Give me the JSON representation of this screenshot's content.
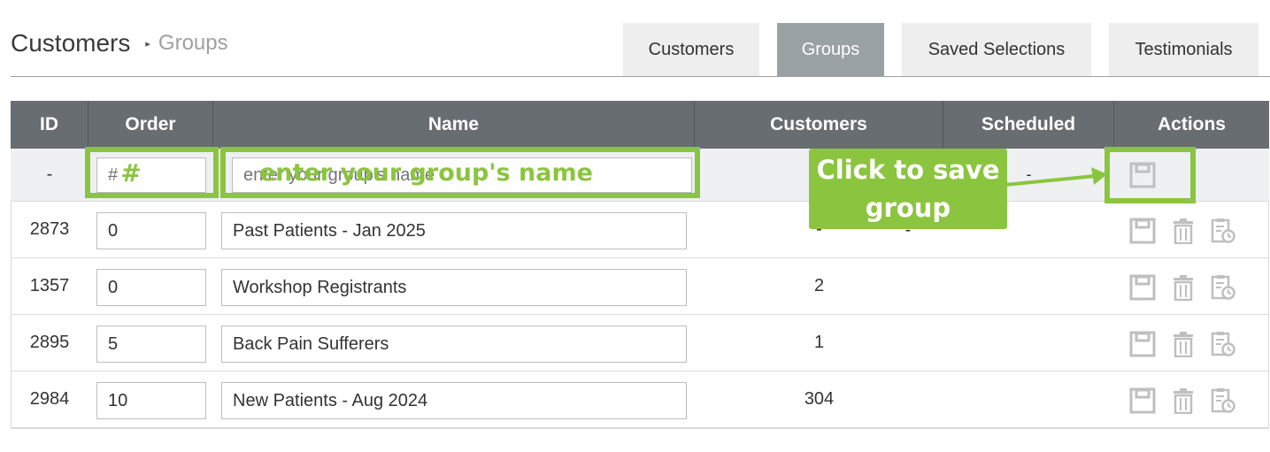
{
  "breadcrumb": {
    "main": "Customers",
    "separator": "▸",
    "current": "Groups"
  },
  "tabs": [
    {
      "label": "Customers",
      "active": false
    },
    {
      "label": "Groups",
      "active": true
    },
    {
      "label": "Saved Selections",
      "active": false
    },
    {
      "label": "Testimonials",
      "active": false
    }
  ],
  "table": {
    "headers": [
      "ID",
      "Order",
      "Name",
      "Customers",
      "Scheduled",
      "Actions"
    ],
    "new_row": {
      "id": "-",
      "order_placeholder": "#",
      "name_placeholder": "enter your group's name",
      "customers": "-",
      "scheduled": "-"
    },
    "rows": [
      {
        "id": "2873",
        "order": "0",
        "name": "Past Patients - Jan 2025",
        "customers": "-",
        "scheduled": ""
      },
      {
        "id": "1357",
        "order": "0",
        "name": "Workshop Registrants",
        "customers": "2",
        "scheduled": ""
      },
      {
        "id": "2895",
        "order": "5",
        "name": "Back Pain Sufferers",
        "customers": "1",
        "scheduled": ""
      },
      {
        "id": "2984",
        "order": "10",
        "name": "New Patients - Aug 2024",
        "customers": "304",
        "scheduled": ""
      }
    ]
  },
  "annotation": {
    "callout": "Click to save group",
    "color": "#8bc53f"
  },
  "icons": {
    "save": "save-icon",
    "delete": "trash-icon",
    "schedule": "schedule-icon"
  },
  "colors": {
    "header_bg": "#686d72",
    "active_tab": "#9aa1a5",
    "tab_bg": "#eeeeee",
    "accent": "#8bc53f"
  }
}
